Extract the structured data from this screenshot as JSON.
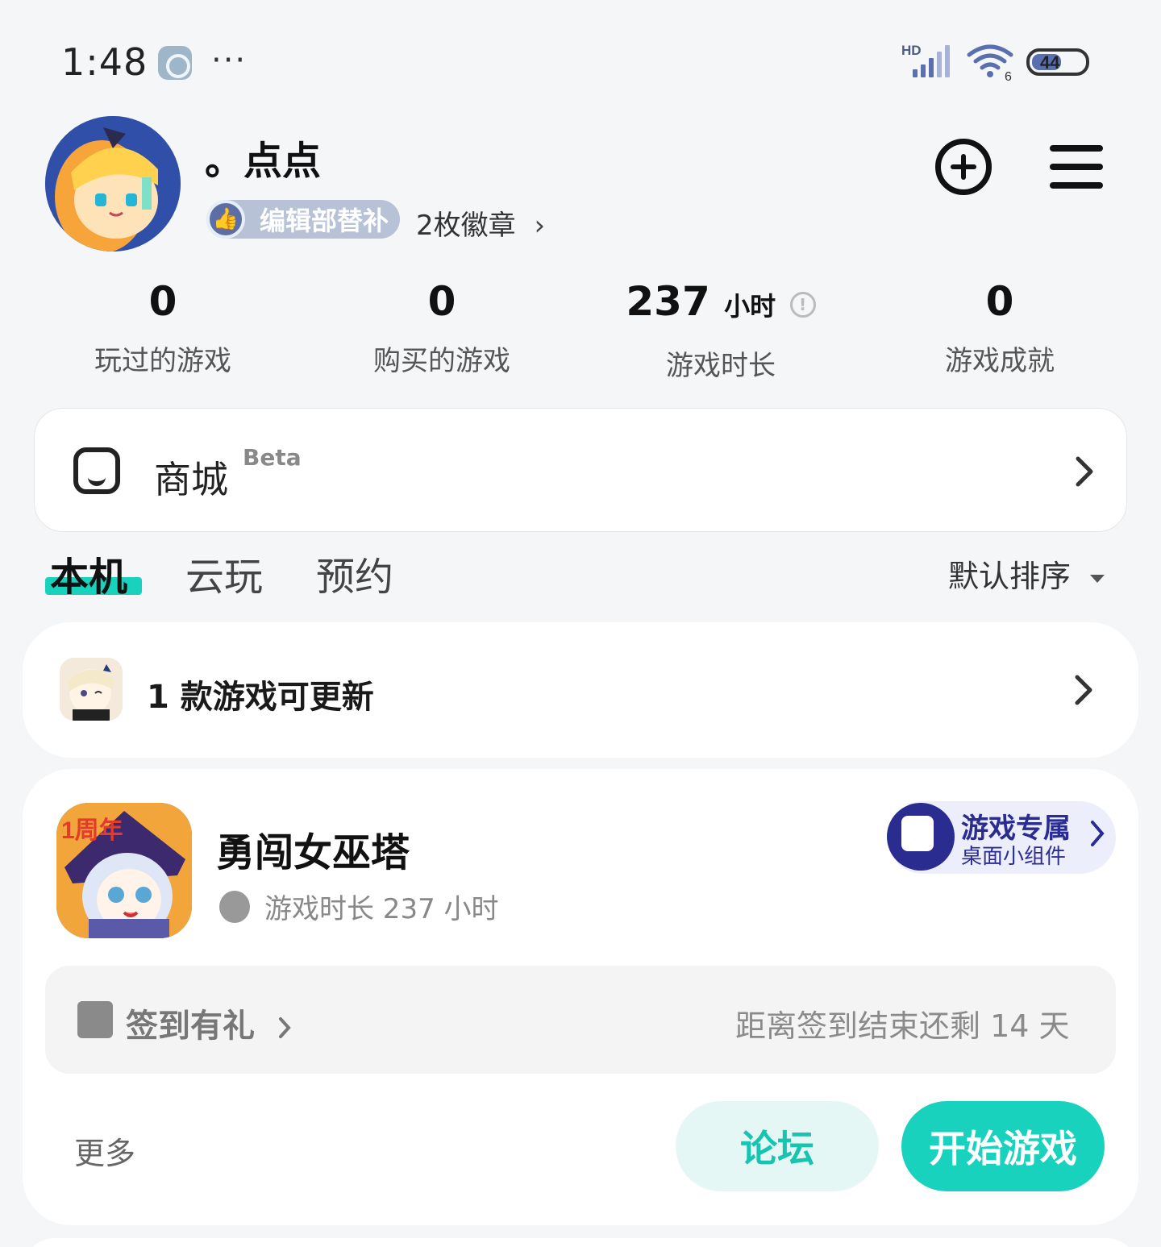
{
  "status_bar": {
    "time": "1:48",
    "dots": "···",
    "network_label": "HD",
    "wifi_label": "6",
    "battery": "44"
  },
  "profile": {
    "username": "。点点",
    "badge_label": "编辑部替补",
    "badges_count": "2枚徽章",
    "badges_chevron": "›"
  },
  "stats": [
    {
      "value": "0",
      "unit": "",
      "label": "玩过的游戏"
    },
    {
      "value": "0",
      "unit": "",
      "label": "购买的游戏"
    },
    {
      "value": "237",
      "unit": "小时",
      "label": "游戏时长"
    },
    {
      "value": "0",
      "unit": "",
      "label": "游戏成就"
    }
  ],
  "mall": {
    "title": "商城",
    "beta": "Beta"
  },
  "tabs": [
    {
      "label": "本机",
      "active": true
    },
    {
      "label": "云玩",
      "active": false
    },
    {
      "label": "预约",
      "active": false
    }
  ],
  "sort": {
    "label": "默认排序"
  },
  "update_notice": {
    "text": "1 款游戏可更新"
  },
  "game": {
    "title": "勇闯女巫塔",
    "playtime": "游戏时长 237 小时",
    "thumb_label": "1周年",
    "widget_title": "游戏专属",
    "widget_sub": "桌面小组件",
    "checkin_label": "签到有礼",
    "checkin_remain": "距离签到结束还剩 14 天",
    "more": "更多",
    "forum_button": "论坛",
    "start_button": "开始游戏"
  },
  "colors": {
    "accent": "#19d2bd",
    "accent_light": "#e5f7f5",
    "widget_brand": "#2a2d8f",
    "background": "#f5f6f8"
  }
}
